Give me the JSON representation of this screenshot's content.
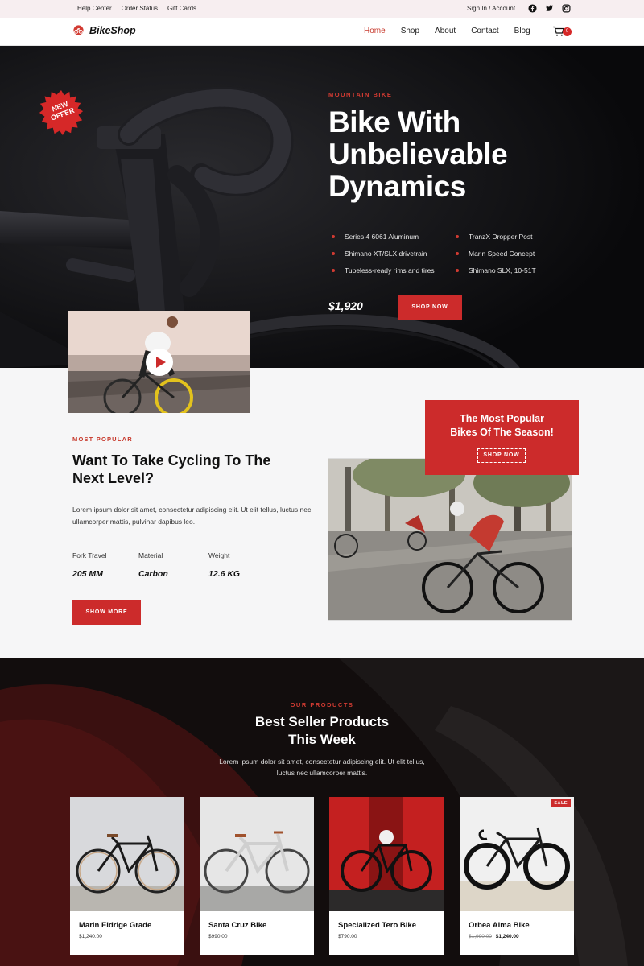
{
  "topbar": {
    "links": [
      "Help Center",
      "Order Status",
      "Gift Cards"
    ],
    "account": "Sign In / Account",
    "socials": [
      "facebook-icon",
      "twitter-icon",
      "instagram-icon"
    ]
  },
  "nav": {
    "brand": "BikeShop",
    "menu": [
      "Home",
      "Shop",
      "About",
      "Contact",
      "Blog"
    ],
    "active": "Home",
    "cart_count": "0"
  },
  "hero": {
    "badge": "NEW OFFER",
    "badge_line1": "NEW",
    "badge_line2": "OFFER",
    "kicker": "MOUNTAIN BIKE",
    "title_line1": "Bike With",
    "title_line2": "Unbelievable",
    "title_line3": "Dynamics",
    "specs_left": [
      "Series 4 6061 Aluminum",
      "Shimano XT/SLX drivetrain",
      "Tubeless-ready rims and tires"
    ],
    "specs_right": [
      "TranzX Dropper Post",
      "Marin Speed Concept",
      "Shimano SLX, 10-51T"
    ],
    "price": "$1,920",
    "cta": "SHOP NOW"
  },
  "feature": {
    "kicker": "MOST POPULAR",
    "title": "Want To Take Cycling To The Next Level?",
    "description": "Lorem ipsum dolor sit amet, consectetur adipiscing elit. Ut elit tellus, luctus nec ullamcorper mattis, pulvinar dapibus leo.",
    "stats": [
      {
        "label": "Fork Travel",
        "value": "205 MM"
      },
      {
        "label": "Material",
        "value": "Carbon"
      },
      {
        "label": "Weight",
        "value": "12.6 KG"
      }
    ],
    "cta": "SHOW MORE",
    "popular_line1": "The Most Popular",
    "popular_line2": "Bikes Of The Season!",
    "popular_cta": "SHOP NOW"
  },
  "products": {
    "kicker": "OUR PRODUCTS",
    "title_line1": "Best Seller Products",
    "title_line2": "This Week",
    "description": "Lorem ipsum dolor sit amet, consectetur adipiscing elit. Ut elit tellus, luctus nec ullamcorper mattis.",
    "items": [
      {
        "name": "Marin Eldrige Grade",
        "price": "$1,240.00"
      },
      {
        "name": "Santa Cruz Bike",
        "price": "$990.00"
      },
      {
        "name": "Specialized Tero Bike",
        "price": "$790.00"
      },
      {
        "name": "Orbea Alma Bike",
        "old_price": "$1,990.00",
        "price": "$1,240.00",
        "badge": "SALE"
      }
    ]
  },
  "colors": {
    "accent": "#cc2b2b",
    "hero_bg": "#0d0d0f",
    "topbar_bg": "#f7eef0"
  }
}
